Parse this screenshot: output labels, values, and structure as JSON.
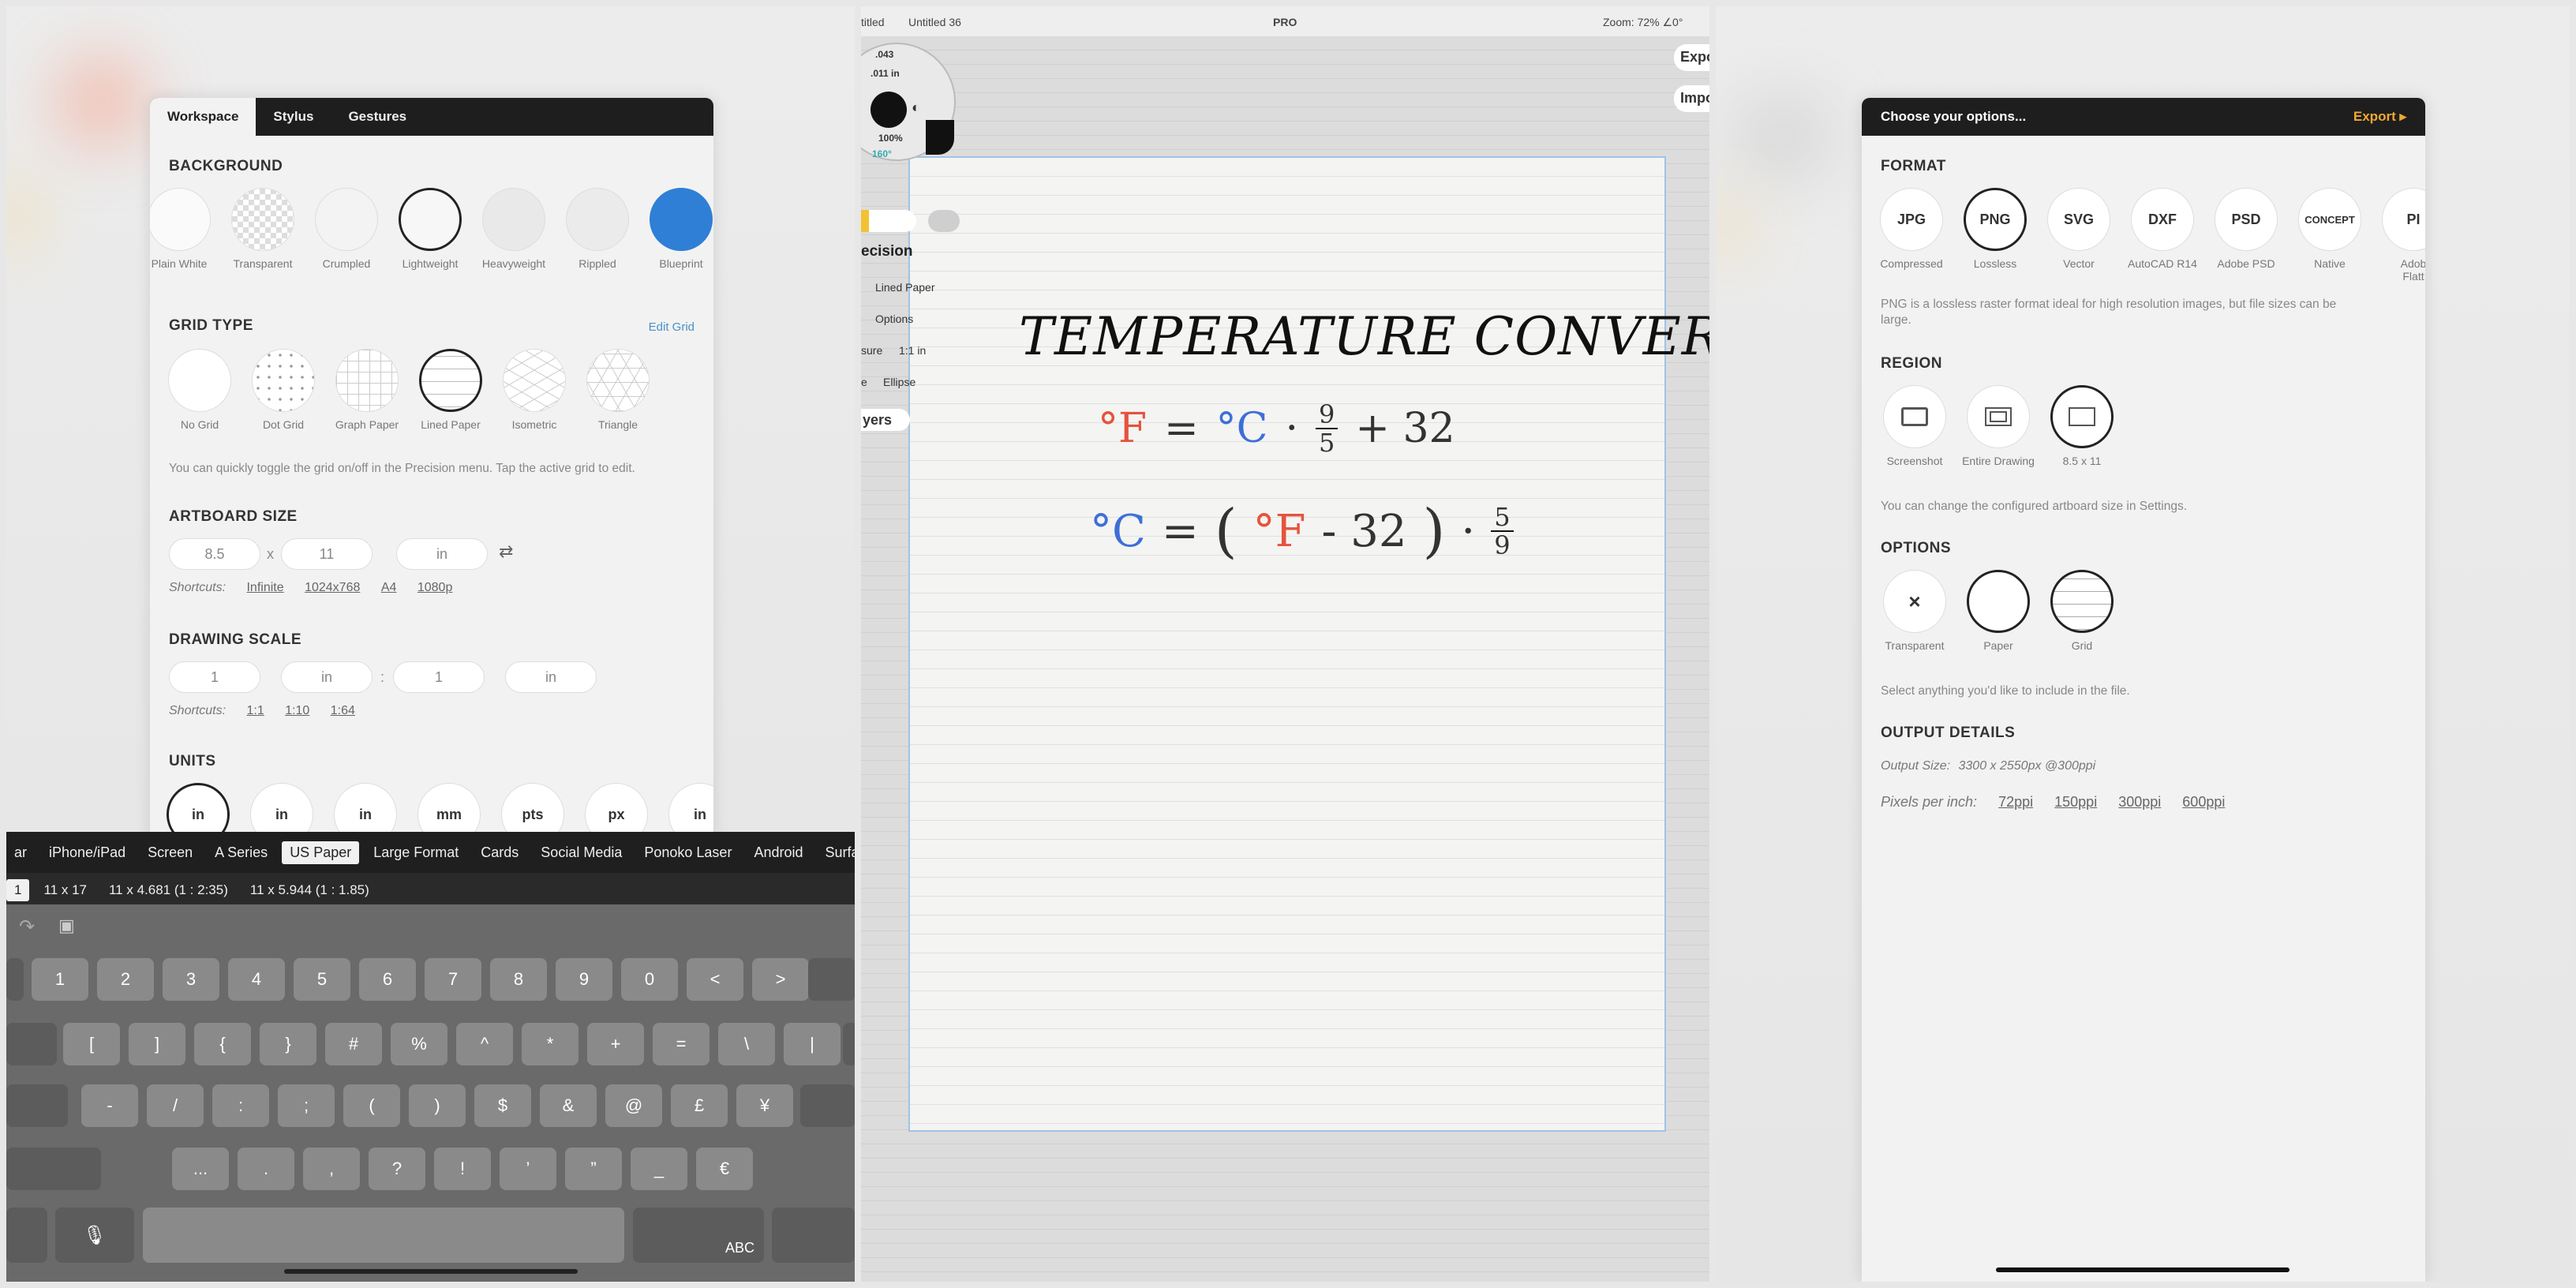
{
  "left": {
    "tabs": [
      "Workspace",
      "Stylus",
      "Gestures"
    ],
    "background": {
      "title": "BACKGROUND",
      "options": [
        "Plain White",
        "Transparent",
        "Crumpled",
        "Lightweight",
        "Heavyweight",
        "Rippled",
        "Blueprint"
      ]
    },
    "grid": {
      "title": "GRID TYPE",
      "edit_link": "Edit Grid",
      "options": [
        "No Grid",
        "Dot Grid",
        "Graph Paper",
        "Lined Paper",
        "Isometric",
        "Triangle"
      ],
      "note": "You can quickly toggle the grid on/off in the Precision menu. Tap the active grid to edit."
    },
    "artboard": {
      "title": "ARTBOARD SIZE",
      "width": "8.5",
      "x_sep": "x",
      "height": "11",
      "unit": "in",
      "shortcuts_label": "Shortcuts:",
      "shortcuts": [
        "Infinite",
        "1024x768",
        "A4",
        "1080p"
      ]
    },
    "scale": {
      "title": "DRAWING SCALE",
      "a": "1",
      "a_unit": "in",
      "sep": ":",
      "b": "1",
      "b_unit": "in",
      "shortcuts_label": "Shortcuts:",
      "shortcuts": [
        "1:1",
        "1:10",
        "1:64"
      ]
    },
    "units": {
      "title": "UNITS",
      "options": [
        "in",
        "in",
        "in",
        "mm",
        "pts",
        "px",
        "in"
      ]
    },
    "category_bar": [
      "ar",
      "iPhone/iPad",
      "Screen",
      "A Series",
      "US Paper",
      "Large Format",
      "Cards",
      "Social Media",
      "Ponoko Laser",
      "Android",
      "Surface"
    ],
    "size_bar": [
      "1",
      "11 x 17",
      "11 x 4.681 (1 : 2:35)",
      "11 x 5.944 (1 : 1.85)"
    ],
    "keyboard": {
      "row1": [
        "1",
        "2",
        "3",
        "4",
        "5",
        "6",
        "7",
        "8",
        "9",
        "0",
        "<",
        ">"
      ],
      "row2": [
        "[",
        "]",
        "{",
        "}",
        "#",
        "%",
        "^",
        "*",
        "+",
        "=",
        "\\",
        "|"
      ],
      "row3": [
        "-",
        "/",
        ":",
        ";",
        "(",
        ")",
        "$",
        "&",
        "@",
        "£",
        "¥"
      ],
      "row4": [
        "...",
        ".",
        ",",
        "?",
        "!",
        "’",
        "”",
        "_",
        "€"
      ],
      "abc": "ABC"
    }
  },
  "mid": {
    "breadcrumb": [
      "titled",
      "Untitled 36"
    ],
    "pro": "PRO",
    "zoom": "Zoom: 72% ∠0°",
    "export_btn": "Expo",
    "import_btn": "Impo",
    "wheel": {
      "size": ".011 in",
      "opacity": "100%",
      "val1": ".043",
      "val2": "160°"
    },
    "menu": {
      "precision": "ecision",
      "lined": "Lined Paper",
      "options": "Options",
      "pressure_label": "sure",
      "pressure_value": "1:1 in",
      "shape_label": "e",
      "shape_value": "Ellipse",
      "layers": "yers"
    },
    "drawing": {
      "title": "TEMPERATURE CONVERSIONS",
      "eq1_f": "°F",
      "eq1_eq": "=",
      "eq1_c": "°C",
      "eq1_dot": "·",
      "eq1_num": "9",
      "eq1_den": "5",
      "eq1_plus": "+ 32",
      "eq2_c": "°C",
      "eq2_eq": "=",
      "eq2_open": "(",
      "eq2_f": "°F",
      "eq2_minus": "- 32",
      "eq2_close": ")",
      "eq2_dot": "·",
      "eq2_num": "5",
      "eq2_den": "9"
    }
  },
  "right": {
    "header": "Choose your options...",
    "export": "Export",
    "format": {
      "title": "FORMAT",
      "options": [
        {
          "code": "JPG",
          "label": "Compressed"
        },
        {
          "code": "PNG",
          "label": "Lossless"
        },
        {
          "code": "SVG",
          "label": "Vector"
        },
        {
          "code": "DXF",
          "label": "AutoCAD R14"
        },
        {
          "code": "PSD",
          "label": "Adobe PSD"
        },
        {
          "code": "CONCEPT",
          "label": "Native"
        },
        {
          "code": "PI",
          "label": "Adob Flatt"
        }
      ],
      "note": "PNG is a lossless raster format ideal for high resolution images, but file sizes can be large."
    },
    "region": {
      "title": "REGION",
      "options": [
        "Screenshot",
        "Entire Drawing",
        "8.5 x 11"
      ],
      "note": "You can change the configured artboard size in Settings."
    },
    "options": {
      "title": "OPTIONS",
      "items": [
        "Transparent",
        "Paper",
        "Grid"
      ],
      "transparent_mark": "×",
      "note": "Select anything you'd like to include in the file."
    },
    "output": {
      "title": "OUTPUT DETAILS",
      "size_label": "Output Size:",
      "size_value": "3300 x 2550px @300ppi",
      "ppi_label": "Pixels per inch:",
      "ppi": [
        "72ppi",
        "150ppi",
        "300ppi",
        "600ppi"
      ]
    }
  }
}
